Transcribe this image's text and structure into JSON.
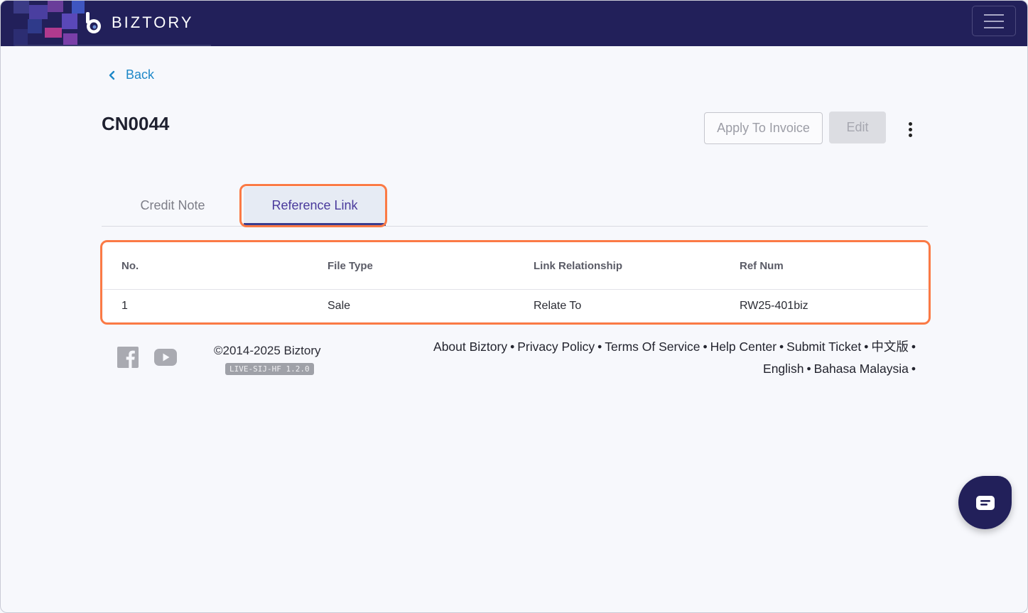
{
  "header": {
    "brand": "BIZTORY",
    "menu_icon": "hamburger-icon"
  },
  "nav": {
    "back_label": "Back"
  },
  "document": {
    "title": "CN0044",
    "apply_label": "Apply To Invoice",
    "edit_label": "Edit"
  },
  "tabs": [
    {
      "label": "Credit Note",
      "active": false
    },
    {
      "label": "Reference Link",
      "active": true
    }
  ],
  "table": {
    "columns": [
      "No.",
      "File Type",
      "Link Relationship",
      "Ref Num"
    ],
    "rows": [
      [
        "1",
        "Sale",
        "Relate To",
        "RW25-401biz"
      ]
    ]
  },
  "footer": {
    "copyright": "©2014-2025 Biztory",
    "version": "LIVE-SIJ-HF 1.2.0",
    "links": [
      "About Biztory",
      "Privacy Policy",
      "Terms Of Service",
      "Help Center",
      "Submit Ticket",
      "中文版",
      "English",
      "Bahasa Malaysia"
    ],
    "separator": "•"
  },
  "colors": {
    "header_bg": "#22205a",
    "accent_link": "#1e88c8",
    "highlight": "#fb7a45",
    "tab_active_text": "#4a3a9c"
  }
}
